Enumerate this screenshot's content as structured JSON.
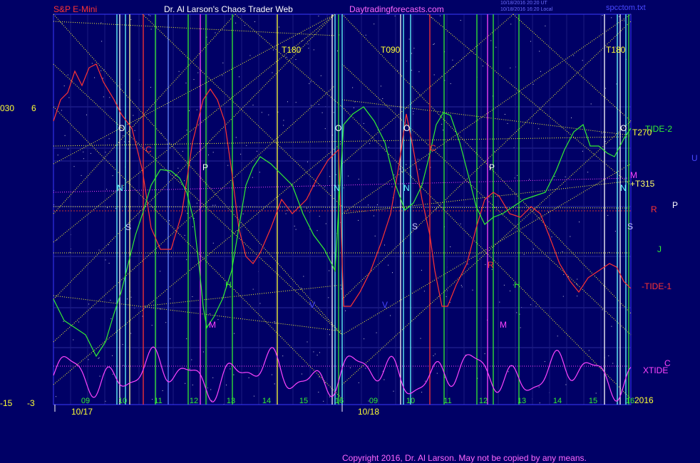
{
  "header": {
    "instrument": "S&P E-Mini",
    "title": "Dr. Al Larson's Chaos Trader Web",
    "site": "Daytradingforecasts.com",
    "timestamp_1": "10/18/2016 20:20 UT",
    "timestamp_2": "10/18/2016 16:20 Local",
    "filename": "spcctom.txt"
  },
  "left_scale": {
    "upper_a": "030",
    "upper_b": "6",
    "lower_a": "-15",
    "lower_b": "-3"
  },
  "right_labels": {
    "tide2": "TIDE-2",
    "t270": "T270",
    "m": "M",
    "t315": "+T315",
    "n": "N",
    "r": "R",
    "p": "P",
    "u": "U",
    "j": "J",
    "tide1": "-TIDE-1",
    "xtide": "XTIDE",
    "c": "C",
    "year": "2016"
  },
  "chart_labels": {
    "t180_1": "T180",
    "t090": "T090",
    "t180_2": "T180",
    "o1": "O",
    "o2": "O",
    "o3": "O",
    "o4": "O",
    "n1": "N",
    "n2": "N",
    "n3": "N",
    "s1": "S",
    "s2": "S",
    "s3": "S",
    "c1": "C",
    "c2": "C",
    "p1": "P",
    "p2": "P",
    "h1": "H",
    "h2": "H",
    "m1": "M",
    "m2": "M",
    "v1": "V",
    "v2": "V",
    "r1": "R"
  },
  "date_labels": {
    "d1": "10/17",
    "d2": "10/18"
  },
  "copyright": "Copyright 2016, Dr. Al Larson. May not be copied by any means.",
  "colors": {
    "background": "#000066",
    "price": "#ff3333",
    "tide2": "#33ee33",
    "xtide": "#ff44ff",
    "yellow": "#ffff33",
    "cyan": "#66ffff",
    "white": "#ffffff",
    "gridlines": "#2a2a99"
  },
  "chart_data": {
    "type": "line",
    "title": "S&P E-Mini",
    "x_axis": {
      "days": [
        "10/17",
        "10/18"
      ],
      "hour_ticks": [
        "09",
        "10",
        "11",
        "12",
        "13",
        "14",
        "15",
        "16",
        "09",
        "10",
        "11",
        "12",
        "13",
        "14",
        "15",
        "16"
      ]
    },
    "y_axis": {
      "left_tick_labels_top": [
        "030",
        "6"
      ],
      "left_tick_labels_bottom": [
        "-15",
        "-3"
      ]
    },
    "series": [
      {
        "name": "TIDE-1",
        "color": "#ff3333"
      },
      {
        "name": "TIDE-2",
        "color": "#33ee33"
      },
      {
        "name": "XTIDE",
        "color": "#ff44ff"
      }
    ],
    "grid": true
  }
}
